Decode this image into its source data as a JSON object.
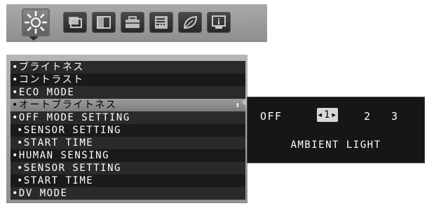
{
  "tabs": [
    {
      "icon": "brightness-sun-icon",
      "active": true
    },
    {
      "icon": "picture-frame-icon",
      "active": false
    },
    {
      "icon": "split-screen-icon",
      "active": false
    },
    {
      "icon": "toolbox-icon",
      "active": false
    },
    {
      "icon": "osd-menu-icon",
      "active": false
    },
    {
      "icon": "leaf-eco-icon",
      "active": false
    },
    {
      "icon": "info-monitor-icon",
      "active": false
    }
  ],
  "menu": {
    "items": [
      {
        "label": "•ブライトネス",
        "indent": false,
        "selected": false
      },
      {
        "label": "•コントラスト",
        "indent": false,
        "selected": false
      },
      {
        "label": "•ECO MODE",
        "indent": false,
        "selected": false
      },
      {
        "label": "•オートブライトネス",
        "indent": false,
        "selected": true
      },
      {
        "label": "•OFF MODE SETTING",
        "indent": false,
        "selected": false
      },
      {
        "label": "•SENSOR SETTING",
        "indent": true,
        "selected": false
      },
      {
        "label": "•START TIME",
        "indent": true,
        "selected": false
      },
      {
        "label": "•HUMAN SENSING",
        "indent": false,
        "selected": false
      },
      {
        "label": "•SENSOR SETTING",
        "indent": true,
        "selected": false
      },
      {
        "label": "•START TIME",
        "indent": true,
        "selected": false
      },
      {
        "label": "•DV MODE",
        "indent": false,
        "selected": false
      }
    ],
    "updown_glyph": "⬍"
  },
  "setting": {
    "options": [
      "OFF",
      "1",
      "2",
      "3"
    ],
    "selected_option": "1",
    "selected_display": "◂1▸",
    "current_mode_label": "AMBIENT LIGHT"
  },
  "colors": {
    "menu_bg": "#2a2a2a",
    "highlight": "#9c9c9c",
    "panel_bg": "#161616"
  }
}
